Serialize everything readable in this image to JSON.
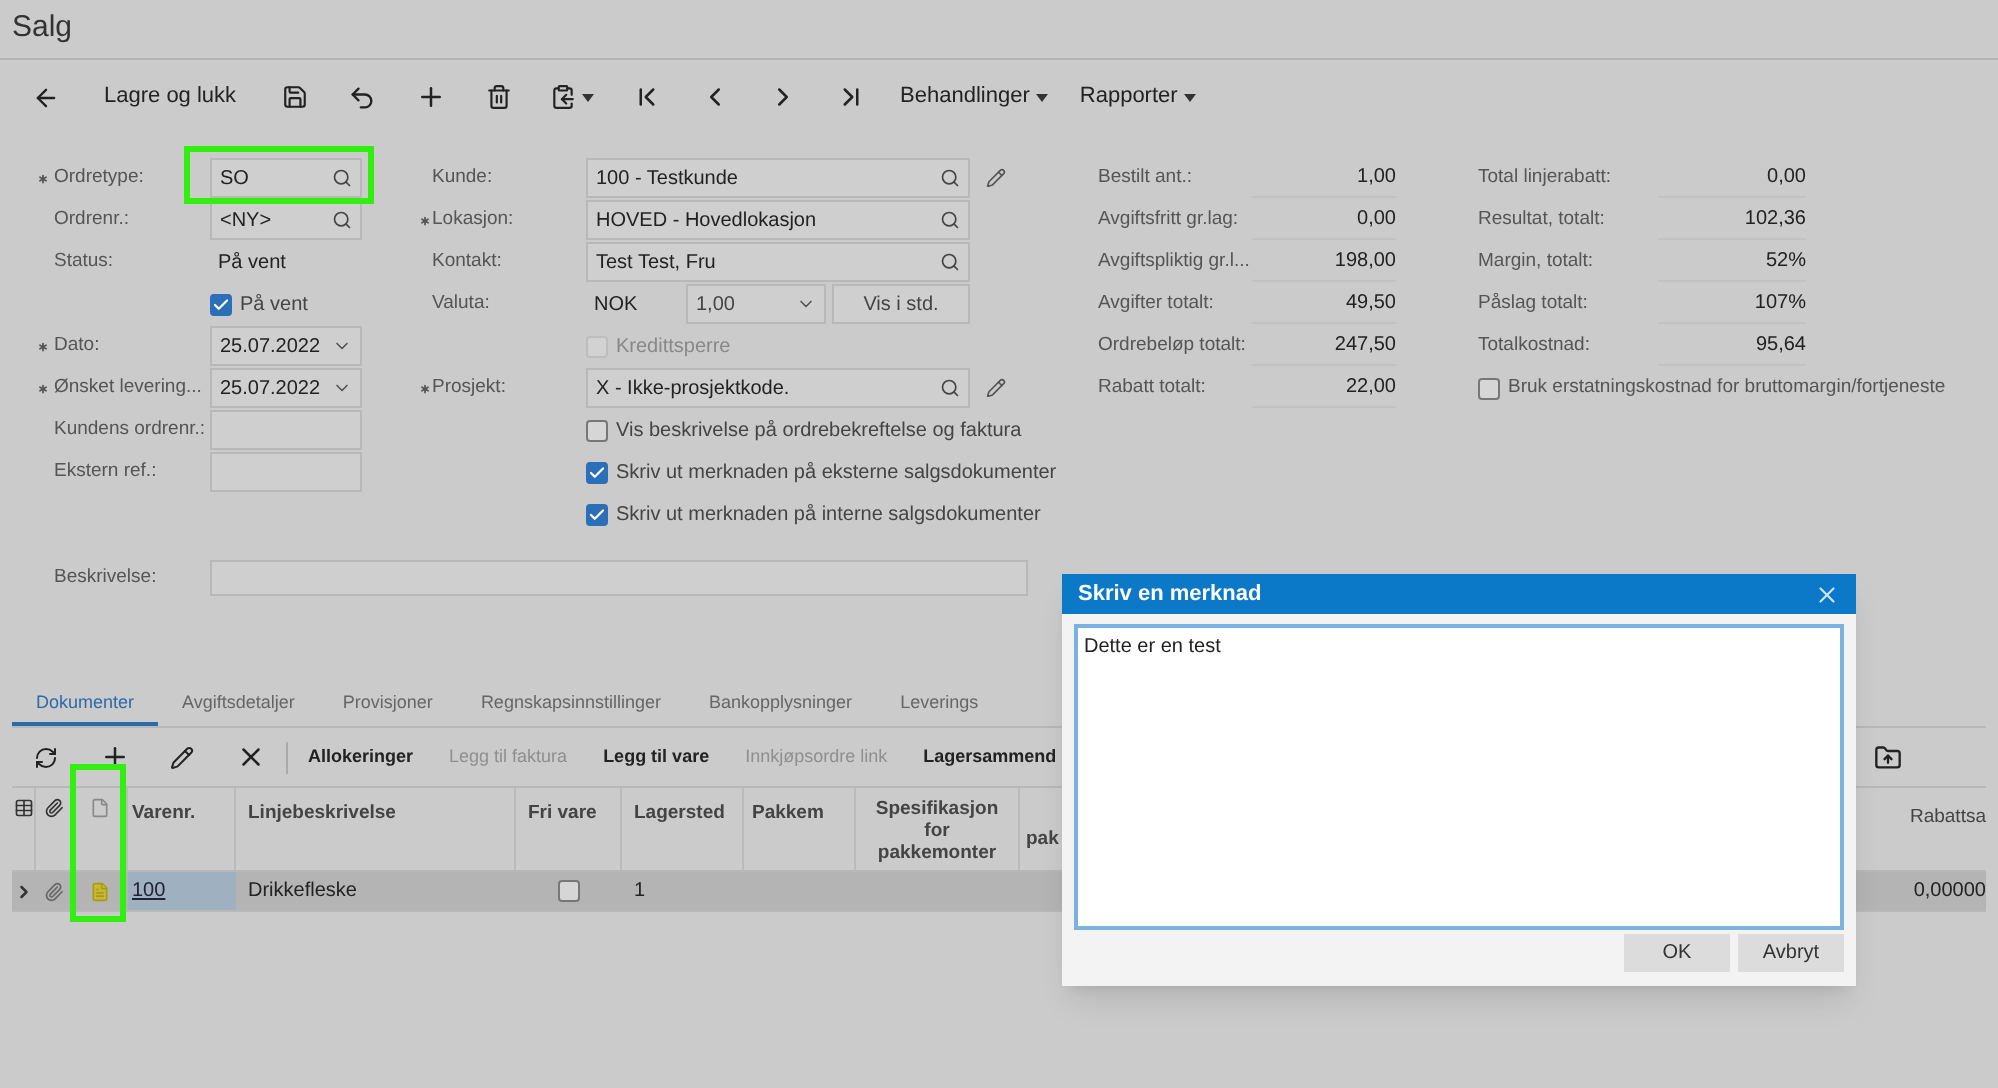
{
  "page_title": "Salg",
  "toolbar": {
    "save_close": "Lagre og lukk",
    "menus": [
      "Behandlinger",
      "Rapporter"
    ]
  },
  "form": {
    "left": [
      {
        "kind": "lookup",
        "label": "Ordretype:",
        "required": true,
        "value": "SO"
      },
      {
        "kind": "lookup",
        "label": "Ordrenr.:",
        "required": false,
        "value": "<NY>"
      },
      {
        "kind": "plain",
        "label": "Status:",
        "required": false,
        "value": "På vent"
      },
      {
        "kind": "checkbox",
        "label": "På vent",
        "checked": true,
        "disabled": false
      },
      {
        "kind": "date",
        "label": "Dato:",
        "required": true,
        "value": "25.07.2022"
      },
      {
        "kind": "date",
        "label": "Ønsket levering...",
        "required": true,
        "value": "25.07.2022"
      },
      {
        "kind": "text",
        "label": "Kundens ordrenr.:",
        "required": false
      },
      {
        "kind": "text",
        "label": "Ekstern ref.:",
        "required": false
      }
    ],
    "middle": [
      {
        "kind": "lookup",
        "label": "Kunde:",
        "required": false,
        "value": "100 - Testkunde",
        "editable": true
      },
      {
        "kind": "lookup",
        "label": "Lokasjon:",
        "required": true,
        "value": "HOVED - Hovedlokasjon",
        "editable": false
      },
      {
        "kind": "lookup",
        "label": "Kontakt:",
        "required": false,
        "value": "Test Test, Fru",
        "editable": false
      },
      {
        "kind": "currency",
        "label": "Valuta:",
        "required": false,
        "value": "NOK",
        "rate": "1,00",
        "button": "Vis i std."
      },
      {
        "kind": "checkbox",
        "label": "Kredittsperre",
        "checked": false,
        "disabled": true
      },
      {
        "kind": "lookup",
        "label": "Prosjekt:",
        "required": true,
        "value": "X - Ikke-prosjektkode.",
        "editable": true
      },
      {
        "kind": "checkbox",
        "label": "Vis beskrivelse på ordrebekreftelse og faktura",
        "checked": false,
        "disabled": false
      },
      {
        "kind": "checkbox",
        "label": "Skriv ut merknaden på eksterne salgsdokumenter",
        "checked": true,
        "disabled": false
      },
      {
        "kind": "checkbox",
        "label": "Skriv ut merknaden på interne salgsdokumenter",
        "checked": true,
        "disabled": false
      }
    ],
    "totals": [
      {
        "label": "Bestilt ant.:",
        "value": "1,00"
      },
      {
        "label": "Avgiftsfritt gr.lag:",
        "value": "0,00"
      },
      {
        "label": "Avgiftspliktig gr.l...",
        "value": "198,00"
      },
      {
        "label": "Avgifter totalt:",
        "value": "49,50"
      },
      {
        "label": "Ordrebeløp totalt:",
        "value": "247,50"
      },
      {
        "label": "Rabatt totalt:",
        "value": "22,00"
      }
    ],
    "margins": [
      {
        "label": "Total linjerabatt:",
        "value": "0,00"
      },
      {
        "label": "Resultat, totalt:",
        "value": "102,36"
      },
      {
        "label": "Margin, totalt:",
        "value": "52%"
      },
      {
        "label": "Påslag totalt:",
        "value": "107%"
      },
      {
        "label": "Totalkostnad:",
        "value": "95,64"
      }
    ],
    "margin_checkbox": {
      "label": "Bruk erstatningskostnad for bruttomargin/fortjeneste",
      "checked": false
    },
    "description": {
      "label": "Beskrivelse:"
    }
  },
  "tabs": [
    {
      "label": "Dokumenter",
      "selected": true
    },
    {
      "label": "Avgiftsdetaljer",
      "selected": false
    },
    {
      "label": "Provisjoner",
      "selected": false
    },
    {
      "label": "Regnskapsinnstillinger",
      "selected": false
    },
    {
      "label": "Bankopplysninger",
      "selected": false
    },
    {
      "label": "Leverings",
      "selected": false
    }
  ],
  "grid_toolbar": [
    {
      "label": "Allokeringer",
      "disabled": false
    },
    {
      "label": "Legg til faktura",
      "disabled": true
    },
    {
      "label": "Legg til vare",
      "disabled": false
    },
    {
      "label": "Innkjøpsordre link",
      "disabled": true
    },
    {
      "label": "Lagersammend",
      "disabled": false
    }
  ],
  "table": {
    "columns": [
      "Varenr.",
      "Linjebeskrivelse",
      "Fri vare",
      "Lagersted",
      "Pakkem",
      "Spesifikasjon for pakkemonter",
      "pak",
      "Rabattsa"
    ],
    "rows": [
      {
        "selected": true,
        "item": "100",
        "description": "Drikkefleske",
        "free": false,
        "warehouse": "1",
        "discount": "0,00000"
      }
    ]
  },
  "dialog": {
    "title": "Skriv en merknad",
    "text": "Dette er en test",
    "buttons": [
      "OK",
      "Avbryt"
    ]
  }
}
